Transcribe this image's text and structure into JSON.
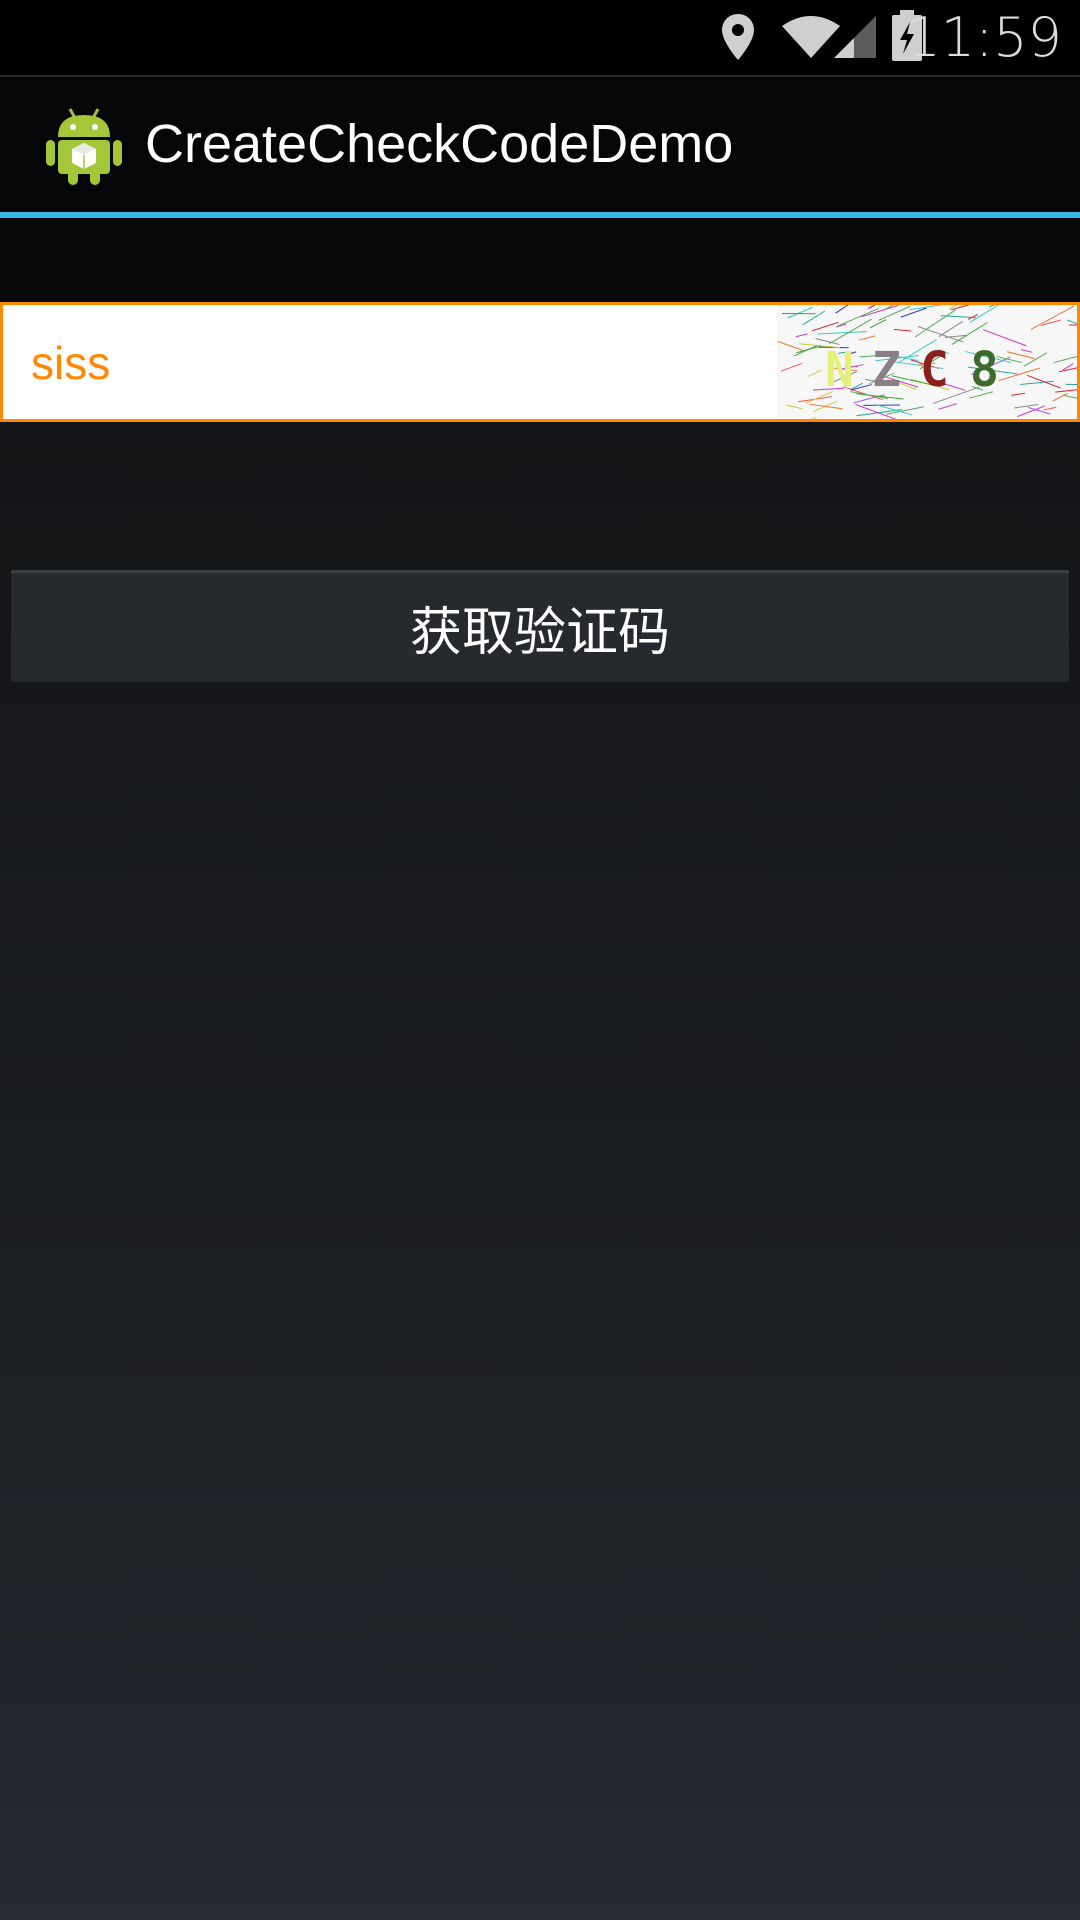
{
  "status_bar": {
    "time": "11:59",
    "icons": [
      "location-icon",
      "wifi-icon",
      "signal-icon",
      "battery-charging-icon"
    ]
  },
  "app": {
    "title": "CreateCheckCodeDemo",
    "icon": "android-robot-icon"
  },
  "form": {
    "code_input_value": "siss",
    "captcha_chars": [
      "N",
      "Z",
      "C",
      "8"
    ],
    "captcha_colors": [
      "#e6ef7a",
      "#8a7f84",
      "#8a1f1c",
      "#3e6b2c"
    ],
    "get_code_button_label": "获取验证码"
  },
  "colors": {
    "accent": "#33b5e5",
    "input_border": "#ff8800",
    "input_text": "#ff8800"
  }
}
